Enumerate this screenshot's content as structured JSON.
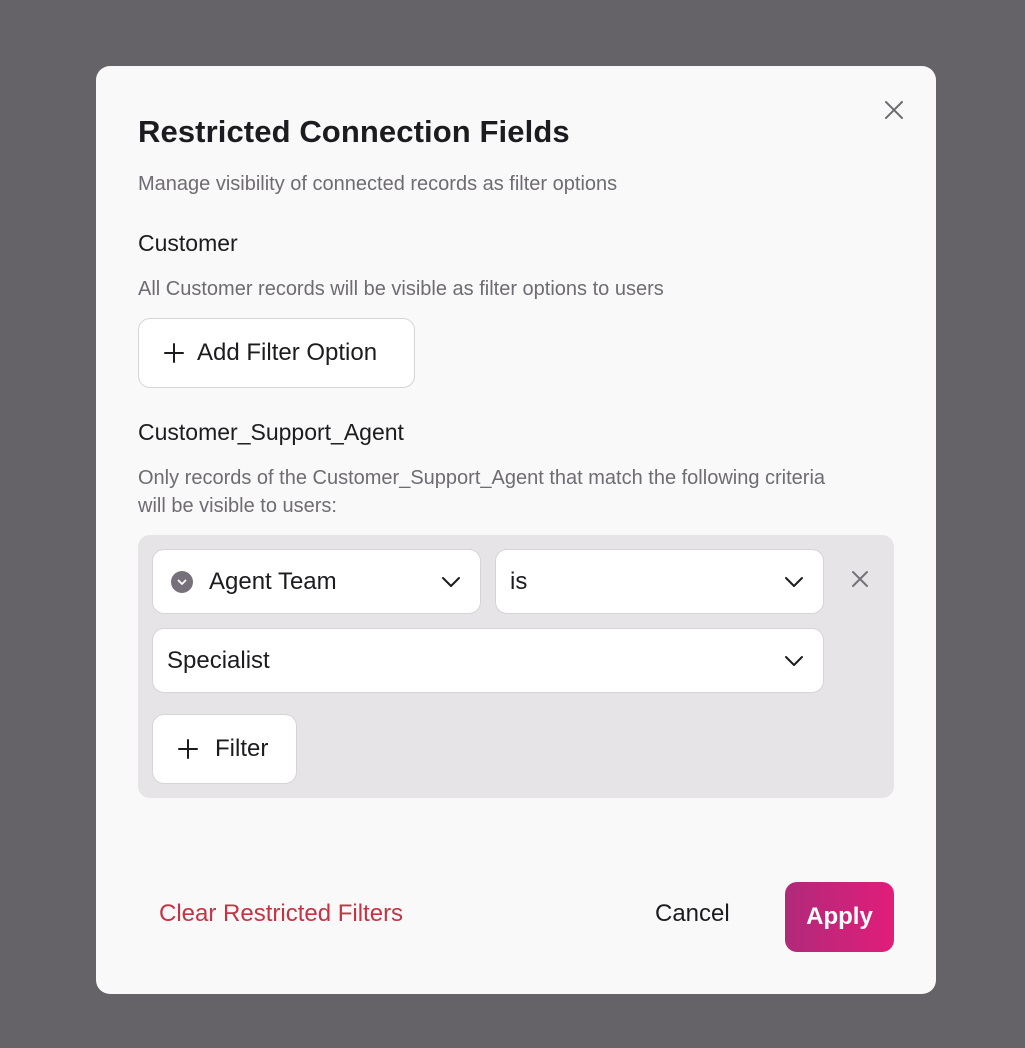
{
  "modal": {
    "title": "Restricted Connection Fields",
    "subtitle": "Manage visibility of connected records as filter options"
  },
  "sections": {
    "customer": {
      "title": "Customer",
      "description": "All Customer records will be visible as filter options to users",
      "add_button_label": "Add Filter Option"
    },
    "support_agent": {
      "title": "Customer_Support_Agent",
      "description": "Only records of the Customer_Support_Agent that match the following criteria will be visible to users:",
      "filter": {
        "field": "Agent Team",
        "operator": "is",
        "value": "Specialist"
      },
      "add_filter_label": "Filter"
    }
  },
  "footer": {
    "clear_label": "Clear Restricted Filters",
    "cancel_label": "Cancel",
    "apply_label": "Apply"
  },
  "colors": {
    "backdrop": "#656367",
    "danger": "#c43445",
    "apply_gradient_start": "#b02a7a",
    "apply_gradient_end": "#e11d7a"
  },
  "icons": [
    "close-icon",
    "plus-icon",
    "chevron-down-icon",
    "field-type-icon",
    "remove-filter-icon"
  ]
}
